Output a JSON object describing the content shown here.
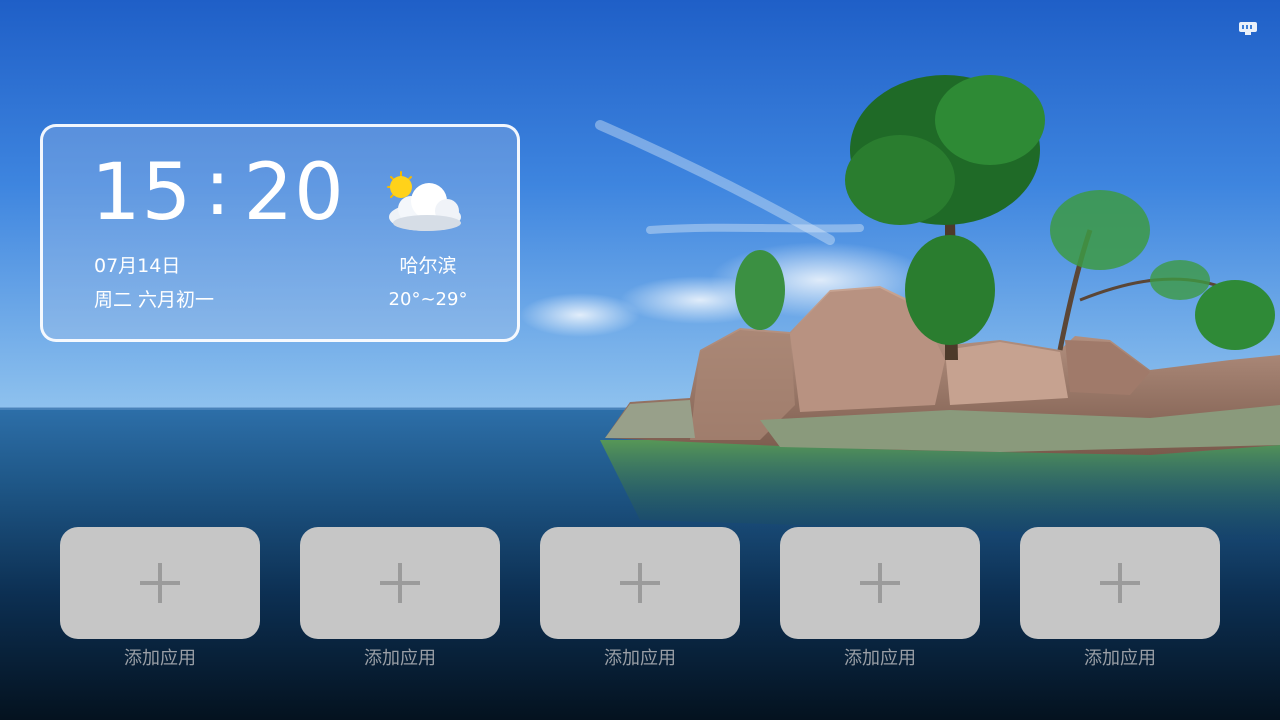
{
  "clock": {
    "hours": "15",
    "separator": ":",
    "minutes": "20"
  },
  "date": {
    "month_day": "07月14日",
    "weekday_lunar": "周二 六月初一"
  },
  "weather": {
    "city": "哈尔滨",
    "temperature_range": "20°~29°",
    "icon": "partly-cloudy-icon"
  },
  "status_bar": {
    "network_icon": "ethernet-icon"
  },
  "app_slots": [
    {
      "label": "添加应用",
      "icon": "plus-icon"
    },
    {
      "label": "添加应用",
      "icon": "plus-icon"
    },
    {
      "label": "添加应用",
      "icon": "plus-icon"
    },
    {
      "label": "添加应用",
      "icon": "plus-icon"
    },
    {
      "label": "添加应用",
      "icon": "plus-icon"
    }
  ],
  "colors": {
    "card_border": "#ffffff",
    "tile_background": "#c6c6c6",
    "plus_color": "#9b9b9b",
    "label_color": "#9a9fa6"
  }
}
